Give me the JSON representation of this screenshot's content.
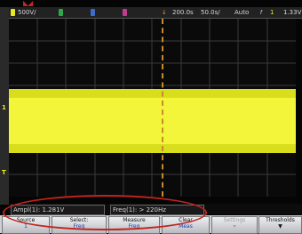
{
  "status": {
    "ch1_scale": "500V/",
    "time_pos": "200.0s",
    "time_scale": "50.0s/",
    "mode": "Auto",
    "trig_level": "1.33V"
  },
  "markers": {
    "ground": "1",
    "trigger": "T"
  },
  "measurements": {
    "amplitude": "Ampl(1): 1.281V",
    "frequency": "Freq(1): > 220Hz"
  },
  "softkeys": [
    {
      "label": "Source",
      "value": "1"
    },
    {
      "label": "Select:",
      "value": "Freq"
    },
    {
      "label": "Measure",
      "value": "Freq"
    },
    {
      "label": "Clear",
      "value": "Meas"
    },
    {
      "label": "Settings",
      "value": ""
    },
    {
      "label": "Thresholds",
      "value": ""
    }
  ],
  "colors": {
    "signal": "#f3f53a",
    "annotation": "#c1241e"
  }
}
